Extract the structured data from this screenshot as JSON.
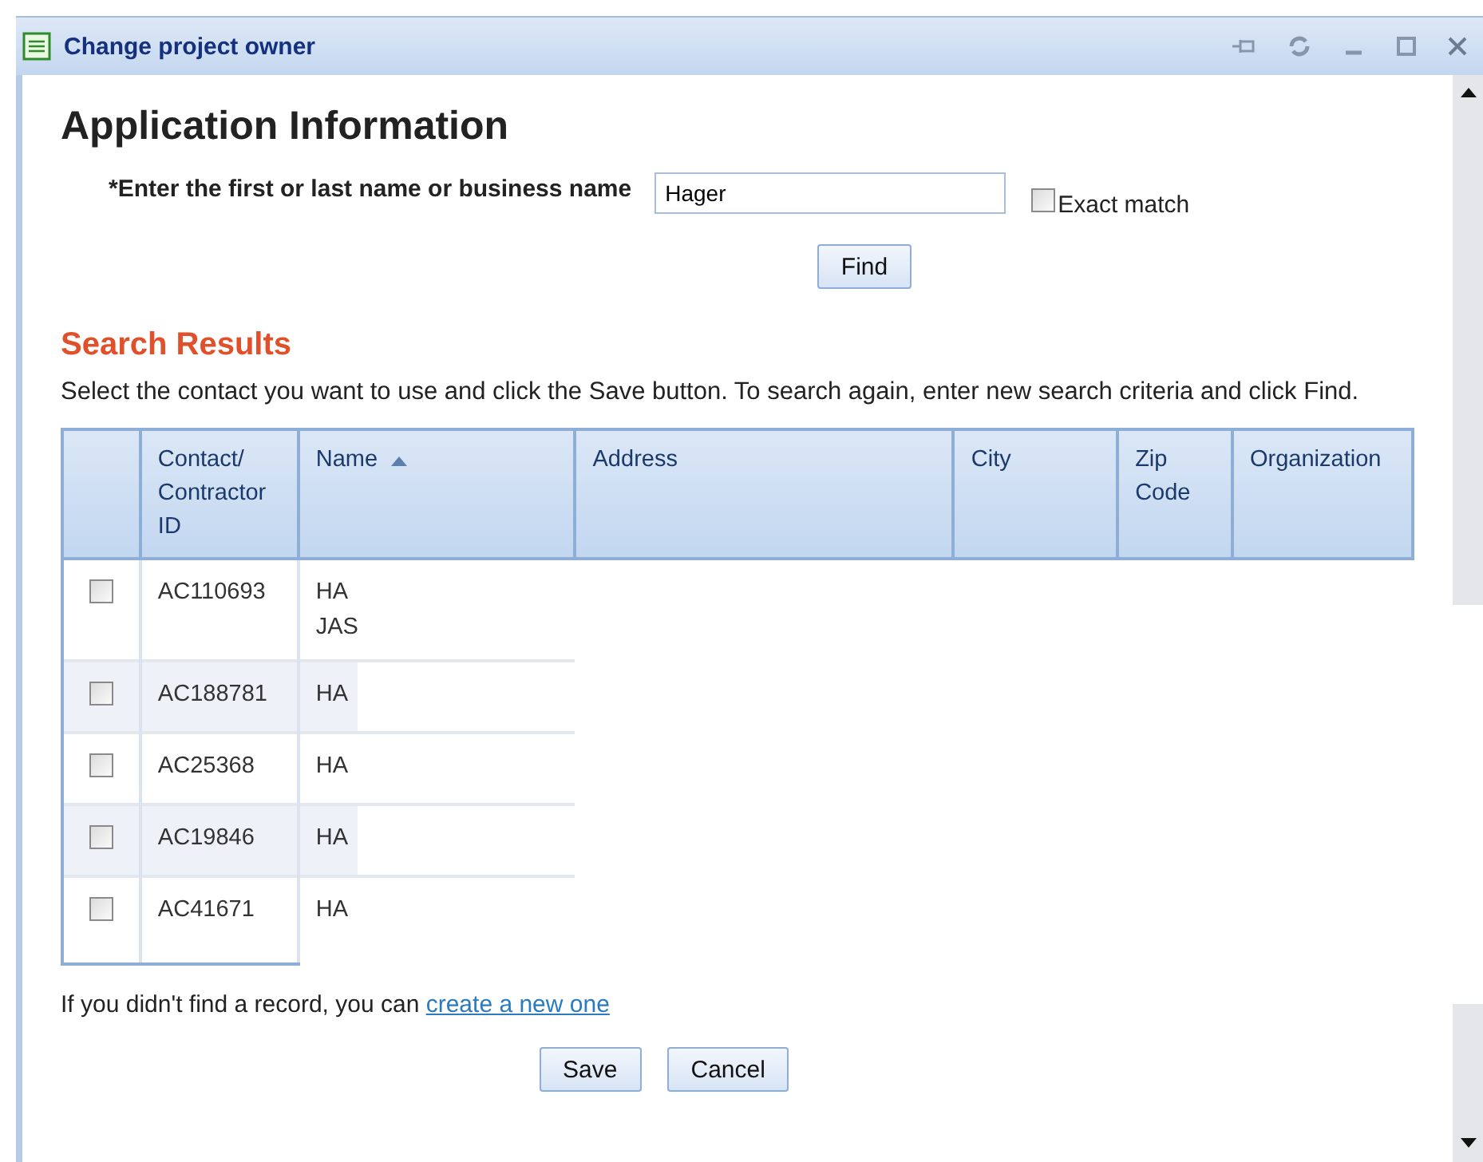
{
  "window": {
    "title": "Change project owner"
  },
  "heading": "Application Information",
  "search": {
    "label": "*Enter the first or last name or business name",
    "value": "Hager",
    "exact_match": {
      "label": "Exact match",
      "checked": false
    },
    "button": "Find"
  },
  "results": {
    "heading": "Search Results",
    "instructions": "Select the contact you want to use and click the Save button. To search again, enter new search criteria and click Find.",
    "columns": [
      {
        "label": "Contact/ Contractor ID",
        "sorted": false
      },
      {
        "label": "Name",
        "sorted": true
      },
      {
        "label": "Address",
        "sorted": false
      },
      {
        "label": "City",
        "sorted": false
      },
      {
        "label": "Zip Code",
        "sorted": false
      },
      {
        "label": "Organization",
        "sorted": false
      }
    ],
    "rows": [
      {
        "checked": false,
        "id": "AC110693",
        "name": [
          "HA",
          "JAS"
        ]
      },
      {
        "checked": false,
        "id": "AC188781",
        "name": [
          "HA"
        ]
      },
      {
        "checked": false,
        "id": "AC25368",
        "name": [
          "HA"
        ]
      },
      {
        "checked": false,
        "id": "AC19846",
        "name": [
          "HA"
        ]
      },
      {
        "checked": false,
        "id": "AC41671",
        "name": [
          "HA"
        ]
      }
    ]
  },
  "footer": {
    "text": "If you didn't find a record, you can",
    "link": "create a new one",
    "buttons": [
      "Save",
      "Cancel"
    ]
  }
}
